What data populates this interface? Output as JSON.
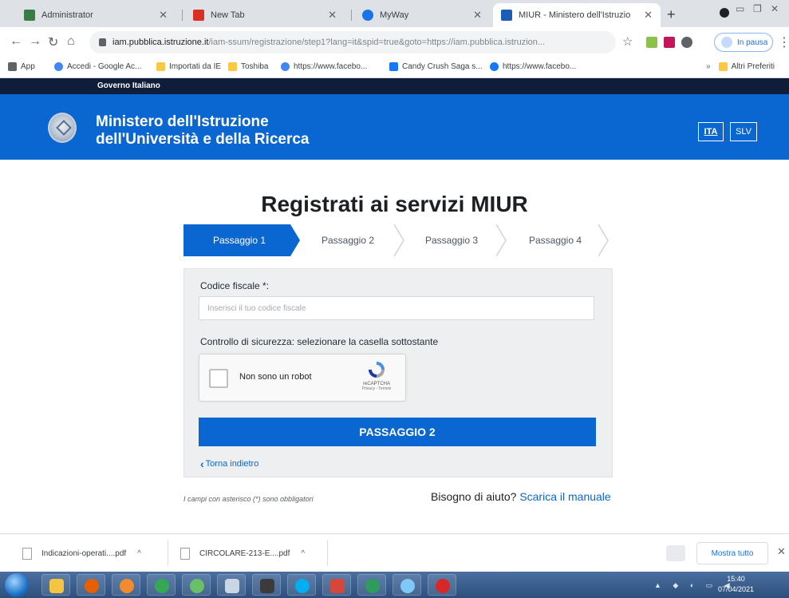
{
  "browser": {
    "tabs": [
      {
        "title": "Administrator",
        "color": "#3a7d44"
      },
      {
        "title": "New Tab",
        "color": "#d93025"
      },
      {
        "title": "MyWay",
        "color": "#1a73e8"
      },
      {
        "title": "MIUR - Ministero dell'Istruzio",
        "color": "#1a5fb4",
        "active": true
      }
    ],
    "new_tab": "+",
    "url_host": "iam.pubblica.istruzione.it",
    "url_path": "/iam-ssum/registrazione/step1?lang=it&spid=true&goto=https://iam.pubblica.istruzion...",
    "pause_label": "In pausa",
    "bookmarks": [
      {
        "label": "App",
        "color": "#5f6368"
      },
      {
        "label": "Accedi - Google Ac...",
        "color": "#4285f4"
      },
      {
        "label": "Importati da IE",
        "color": "#f9c846"
      },
      {
        "label": "Toshiba",
        "color": "#f9c846"
      },
      {
        "label": "https://www.facebo...",
        "color": "#4285f4"
      },
      {
        "label": "Candy Crush Saga s...",
        "color": "#1877f2"
      },
      {
        "label": "https://www.facebo...",
        "color": "#1877f2"
      }
    ],
    "other_bookmarks": "Altri Preferiti"
  },
  "gov": {
    "strip_label": "Governo Italiano",
    "ministry_line1": "Ministero dell'Istruzione",
    "ministry_line2": "dell'Università e della Ricerca",
    "lang_ita": "ITA",
    "lang_slv": "SLV",
    "brand_color": "#0a66d0"
  },
  "page": {
    "title": "Registrati ai servizi MIUR",
    "steps": [
      {
        "label": "Passaggio 1",
        "active": true
      },
      {
        "label": "Passaggio 2",
        "active": false
      },
      {
        "label": "Passaggio 3",
        "active": false
      },
      {
        "label": "Passaggio 4",
        "active": false
      }
    ],
    "form": {
      "cf_label": "Codice fiscale *:",
      "cf_placeholder": "Inserisci il tuo codice fiscale",
      "cf_value": "",
      "security_label": "Controllo di sicurezza: selezionare la casella sottostante",
      "captcha_label": "Non sono un robot",
      "captcha_brand": "reCAPTCHA",
      "captcha_terms": "Privacy - Termini",
      "next_button": "PASSAGGIO 2",
      "back_link": "Torna indietro"
    },
    "required_note": "I campi con asterisco (*) sono obbligatori",
    "help_text": "Bisogno di aiuto?",
    "help_link": "Scarica il manuale"
  },
  "downloads": {
    "items": [
      {
        "name": "Indicazioni-operati....pdf"
      },
      {
        "name": "CIRCOLARE-213-E....pdf"
      }
    ],
    "show_all": "Mostra tutto"
  },
  "taskbar": {
    "time": "15:40",
    "date": "07/04/2021"
  }
}
